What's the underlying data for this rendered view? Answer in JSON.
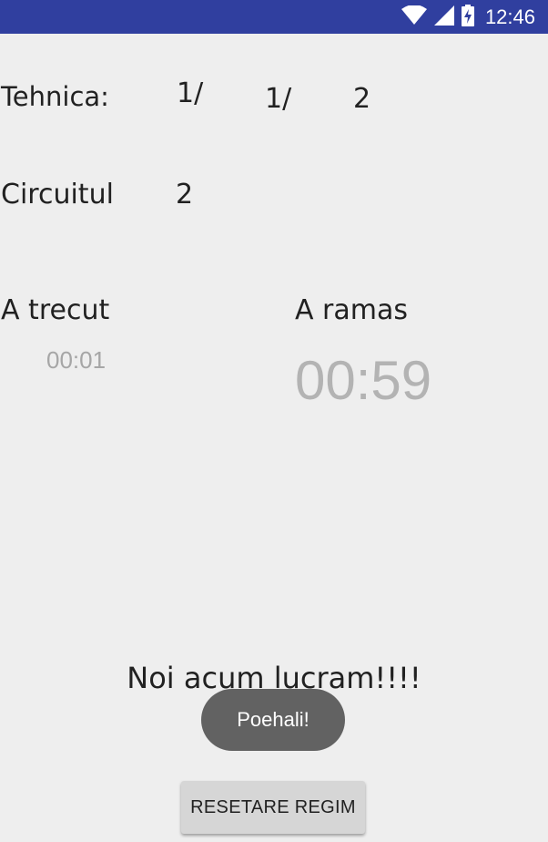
{
  "status_bar": {
    "time": "12:46",
    "wifi_icon": "wifi-icon",
    "signal_icon": "signal-icon",
    "battery_icon": "battery-charging-icon",
    "color": "#303f9f"
  },
  "technique": {
    "label": "Tehnica:",
    "value_a": "1/",
    "value_b": "1/",
    "value_c": "2"
  },
  "circuit": {
    "label": "Circuitul",
    "value": "2"
  },
  "elapsed": {
    "label": "A trecut",
    "time": "00:01"
  },
  "remaining": {
    "label": "A ramas",
    "time": "00:59"
  },
  "status_message": "Noi acum lucram!!!!",
  "toast": "Poehali!",
  "reset_button": {
    "label": "RESETARE REGIM"
  }
}
